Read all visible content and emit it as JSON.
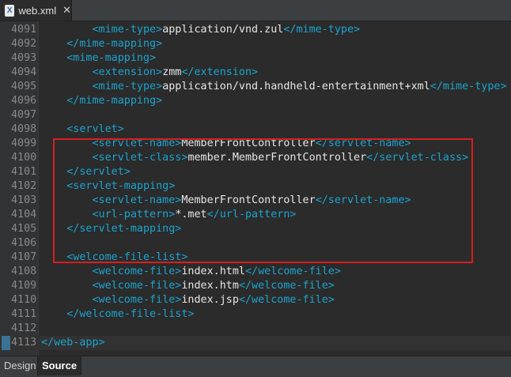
{
  "tab": {
    "filename": "web.xml",
    "icon": "xml-file-icon",
    "close": "✕",
    "icon_letter": "X"
  },
  "editor": {
    "lines": [
      {
        "n": "4091",
        "indent": "        ",
        "open": "<mime-type>",
        "text": "application/vnd.zul",
        "close": "</mime-type>"
      },
      {
        "n": "4092",
        "indent": "    ",
        "open": "</mime-mapping>",
        "text": "",
        "close": ""
      },
      {
        "n": "4093",
        "indent": "    ",
        "open": "<mime-mapping>",
        "text": "",
        "close": ""
      },
      {
        "n": "4094",
        "indent": "        ",
        "open": "<extension>",
        "text": "zmm",
        "close": "</extension>"
      },
      {
        "n": "4095",
        "indent": "        ",
        "open": "<mime-type>",
        "text": "application/vnd.handheld-entertainment+xml",
        "close": "</mime-type>"
      },
      {
        "n": "4096",
        "indent": "    ",
        "open": "</mime-mapping>",
        "text": "",
        "close": ""
      },
      {
        "n": "4097",
        "indent": "",
        "open": "",
        "text": "",
        "close": ""
      },
      {
        "n": "4098",
        "indent": "    ",
        "open": "<servlet>",
        "text": "",
        "close": ""
      },
      {
        "n": "4099",
        "indent": "        ",
        "open": "<servlet-name>",
        "text": "MemberFrontController",
        "close": "</servlet-name>"
      },
      {
        "n": "4100",
        "indent": "        ",
        "open": "<servlet-class>",
        "text": "member.MemberFrontController",
        "close": "</servlet-class>"
      },
      {
        "n": "4101",
        "indent": "    ",
        "open": "</servlet>",
        "text": "",
        "close": ""
      },
      {
        "n": "4102",
        "indent": "    ",
        "open": "<servlet-mapping>",
        "text": "",
        "close": ""
      },
      {
        "n": "4103",
        "indent": "        ",
        "open": "<servlet-name>",
        "text": "MemberFrontController",
        "close": "</servlet-name>"
      },
      {
        "n": "4104",
        "indent": "        ",
        "open": "<url-pattern>",
        "text": "*.met",
        "close": "</url-pattern>"
      },
      {
        "n": "4105",
        "indent": "    ",
        "open": "</servlet-mapping>",
        "text": "",
        "close": ""
      },
      {
        "n": "4106",
        "indent": "",
        "open": "",
        "text": "",
        "close": ""
      },
      {
        "n": "4107",
        "indent": "    ",
        "open": "<welcome-file-list>",
        "text": "",
        "close": ""
      },
      {
        "n": "4108",
        "indent": "        ",
        "open": "<welcome-file>",
        "text": "index.html",
        "close": "</welcome-file>"
      },
      {
        "n": "4109",
        "indent": "        ",
        "open": "<welcome-file>",
        "text": "index.htm",
        "close": "</welcome-file>"
      },
      {
        "n": "4110",
        "indent": "        ",
        "open": "<welcome-file>",
        "text": "index.jsp",
        "close": "</welcome-file>"
      },
      {
        "n": "4111",
        "indent": "    ",
        "open": "</welcome-file-list>",
        "text": "",
        "close": ""
      },
      {
        "n": "4112",
        "indent": "",
        "open": "",
        "text": "",
        "close": ""
      },
      {
        "n": "4113",
        "indent": "",
        "open": "</web-app>",
        "text": "",
        "close": ""
      }
    ],
    "highlight_color": "#d81f1f",
    "tag_color": "#1ba4cf",
    "text_color": "#e6e6e6"
  },
  "bottom_tabs": {
    "design": "Design",
    "source": "Source"
  }
}
